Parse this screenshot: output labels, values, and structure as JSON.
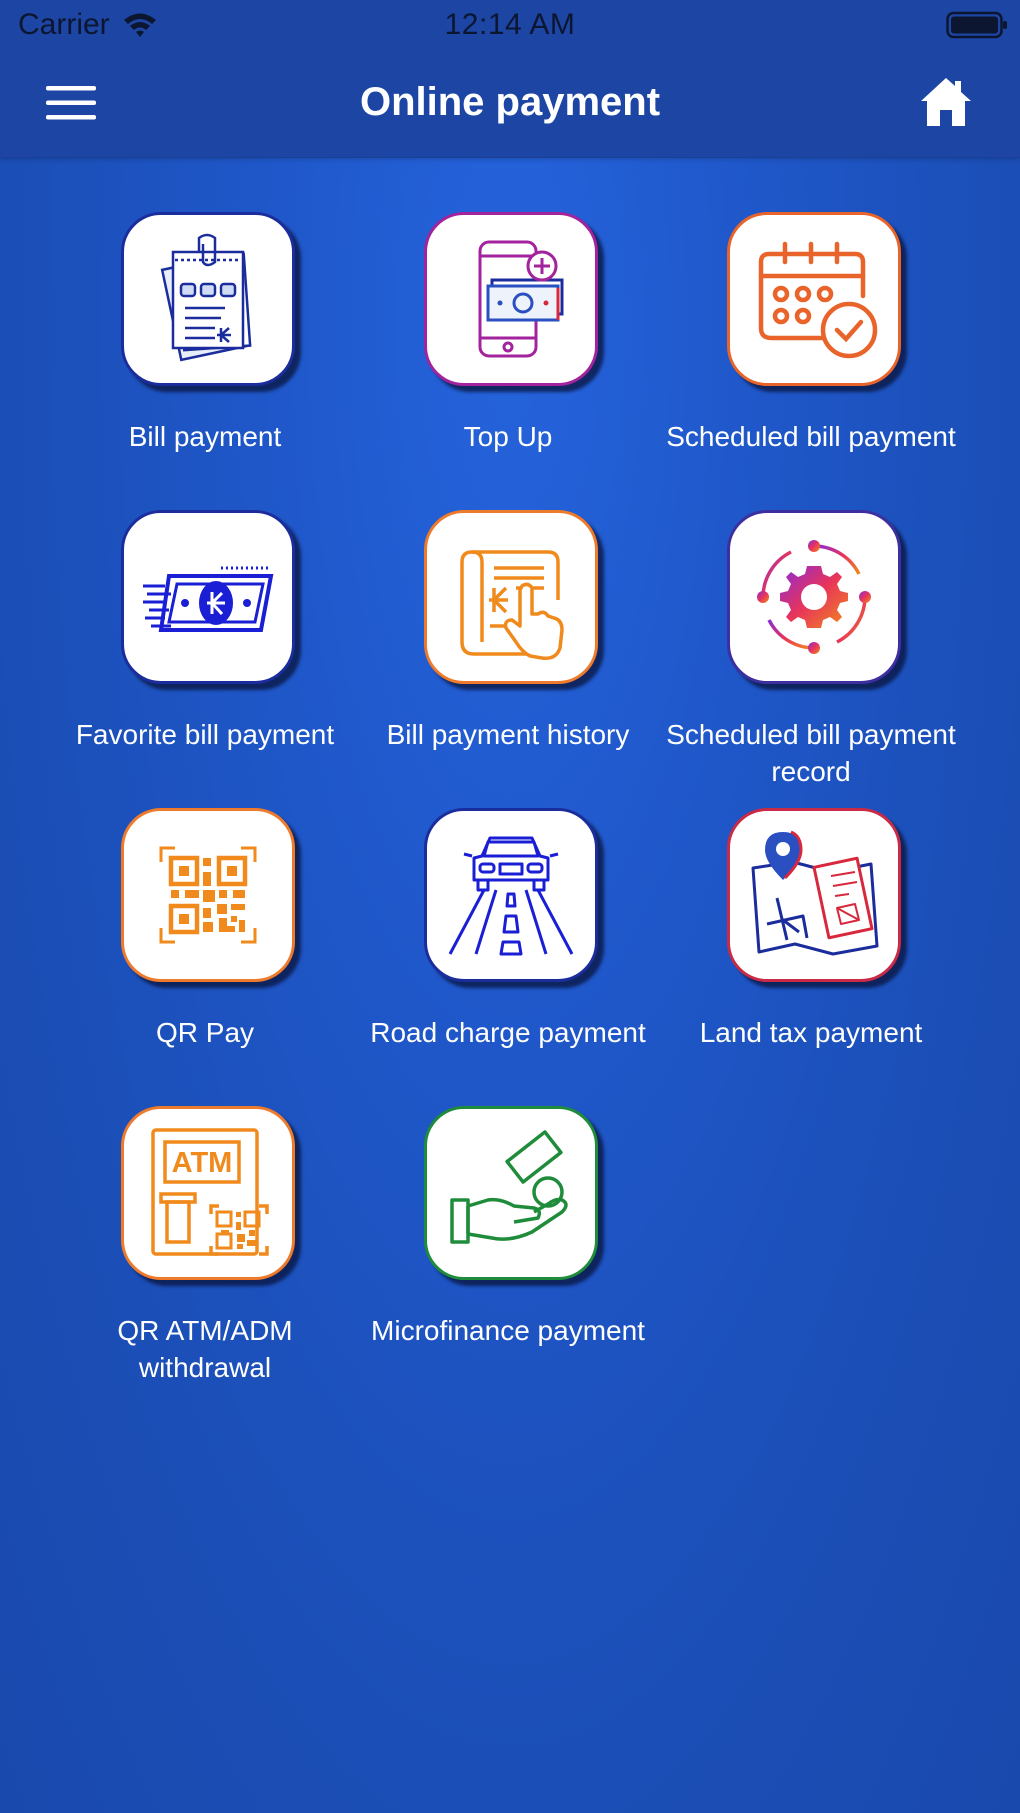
{
  "status_bar": {
    "carrier": "Carrier",
    "time": "12:14 AM",
    "wifi_icon": "wifi-icon",
    "battery_icon": "battery-icon"
  },
  "header": {
    "title": "Online payment",
    "menu_icon": "hamburger-menu-icon",
    "home_icon": "home-icon"
  },
  "colors": {
    "background": "#1f57c9",
    "header": "#1c45a4",
    "tile": "#ffffff"
  },
  "grid": {
    "items": [
      {
        "label": "Bill payment",
        "icon": "bill-document-icon",
        "border": "#1b2d9c"
      },
      {
        "label": "Top Up",
        "icon": "phone-topup-icon",
        "border": "#a2239c"
      },
      {
        "label": "Scheduled bill payment",
        "icon": "calendar-check-icon",
        "border": "#e8642a"
      },
      {
        "label": "Favorite bill payment",
        "icon": "banknote-icon",
        "border": "#1b2d9c"
      },
      {
        "label": "Bill payment history",
        "icon": "history-scroll-icon",
        "border": "#ee7a2c"
      },
      {
        "label": "Scheduled bill payment record",
        "icon": "gear-cycle-icon",
        "border": "#3d2fa0"
      },
      {
        "label": "QR Pay",
        "icon": "qr-code-icon",
        "border": "#ee7a2c"
      },
      {
        "label": "Road charge payment",
        "icon": "car-road-icon",
        "border": "#1b2d9c"
      },
      {
        "label": "Land tax payment",
        "icon": "land-map-icon",
        "border": "#c92a45"
      },
      {
        "label": "QR ATM/ADM withdrawal",
        "icon": "atm-qr-icon",
        "border": "#ee7a2c"
      },
      {
        "label": "Microfinance payment",
        "icon": "hand-coin-icon",
        "border": "#1e8c3a"
      }
    ]
  }
}
